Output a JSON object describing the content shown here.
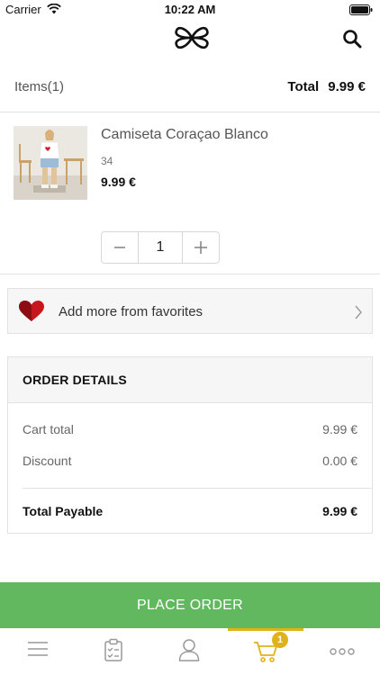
{
  "status_bar": {
    "carrier": "Carrier",
    "time": "10:22 AM"
  },
  "nav": {
    "logo_icon": "bow-logo-icon",
    "search_icon": "search-icon"
  },
  "summary": {
    "items_label": "Items(1)",
    "total_label": "Total",
    "total_value": "9.99 €"
  },
  "cart": {
    "items": [
      {
        "name": "Camiseta Coraçao Blanco",
        "size": "34",
        "price": "9.99 €",
        "quantity": "1"
      }
    ]
  },
  "favorites": {
    "label": "Add more from favorites",
    "icon": "heart-icon"
  },
  "order_details": {
    "title": "ORDER DETAILS",
    "lines": [
      {
        "label": "Cart total",
        "value": "9.99 €"
      },
      {
        "label": "Discount",
        "value": "0.00 €"
      }
    ],
    "payable_label": "Total Payable",
    "payable_value": "9.99 €"
  },
  "place_order": {
    "label": "PLACE ORDER"
  },
  "tab_bar": {
    "tabs": [
      {
        "icon": "menu-icon"
      },
      {
        "icon": "orders-clipboard-icon"
      },
      {
        "icon": "profile-icon"
      },
      {
        "icon": "cart-icon",
        "active": true
      },
      {
        "icon": "more-icon"
      }
    ],
    "cart_badge": "1"
  },
  "colors": {
    "accent_green": "#62b85e",
    "active_tab_yellow": "#e0b21a",
    "heart_red": "#c8161d"
  }
}
